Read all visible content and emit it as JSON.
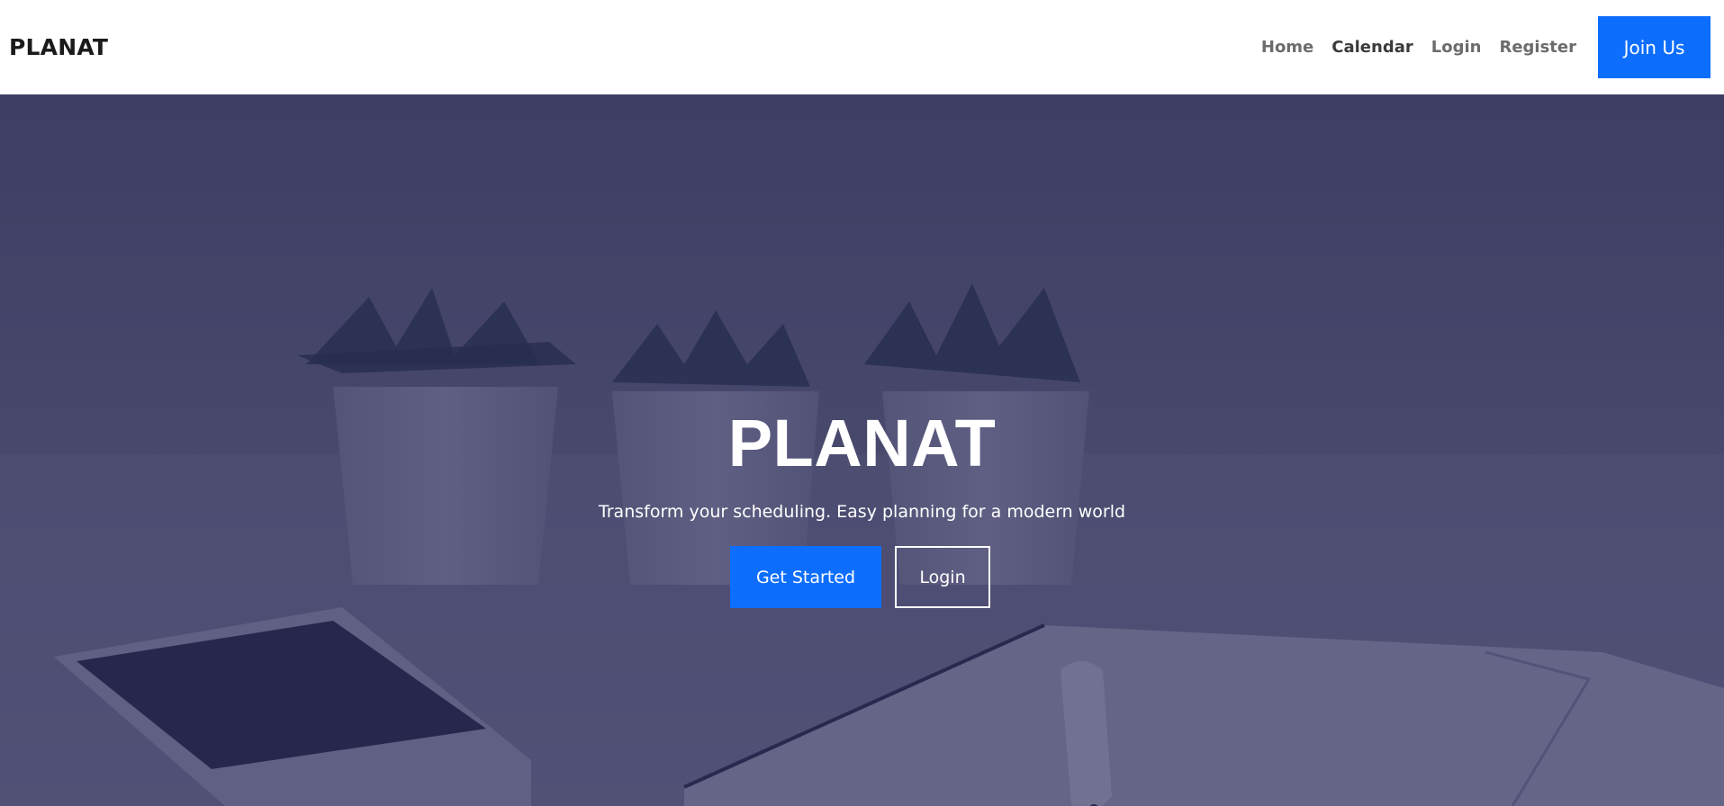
{
  "navbar": {
    "brand": "PLANAT",
    "links": [
      {
        "label": "Home",
        "active": false
      },
      {
        "label": "Calendar",
        "active": true
      },
      {
        "label": "Login",
        "active": false
      },
      {
        "label": "Register",
        "active": false
      }
    ],
    "cta_label": "Join Us"
  },
  "hero": {
    "title": "PLANAT",
    "subtitle": "Transform your scheduling. Easy planning for a modern world",
    "primary_button": "Get Started",
    "secondary_button": "Login"
  },
  "colors": {
    "accent": "#0d6efd",
    "hero_overlay": "#242454",
    "nav_text": "#6c6c6c",
    "nav_active": "#3b3b3b",
    "brand_text": "#1a1a1a"
  }
}
